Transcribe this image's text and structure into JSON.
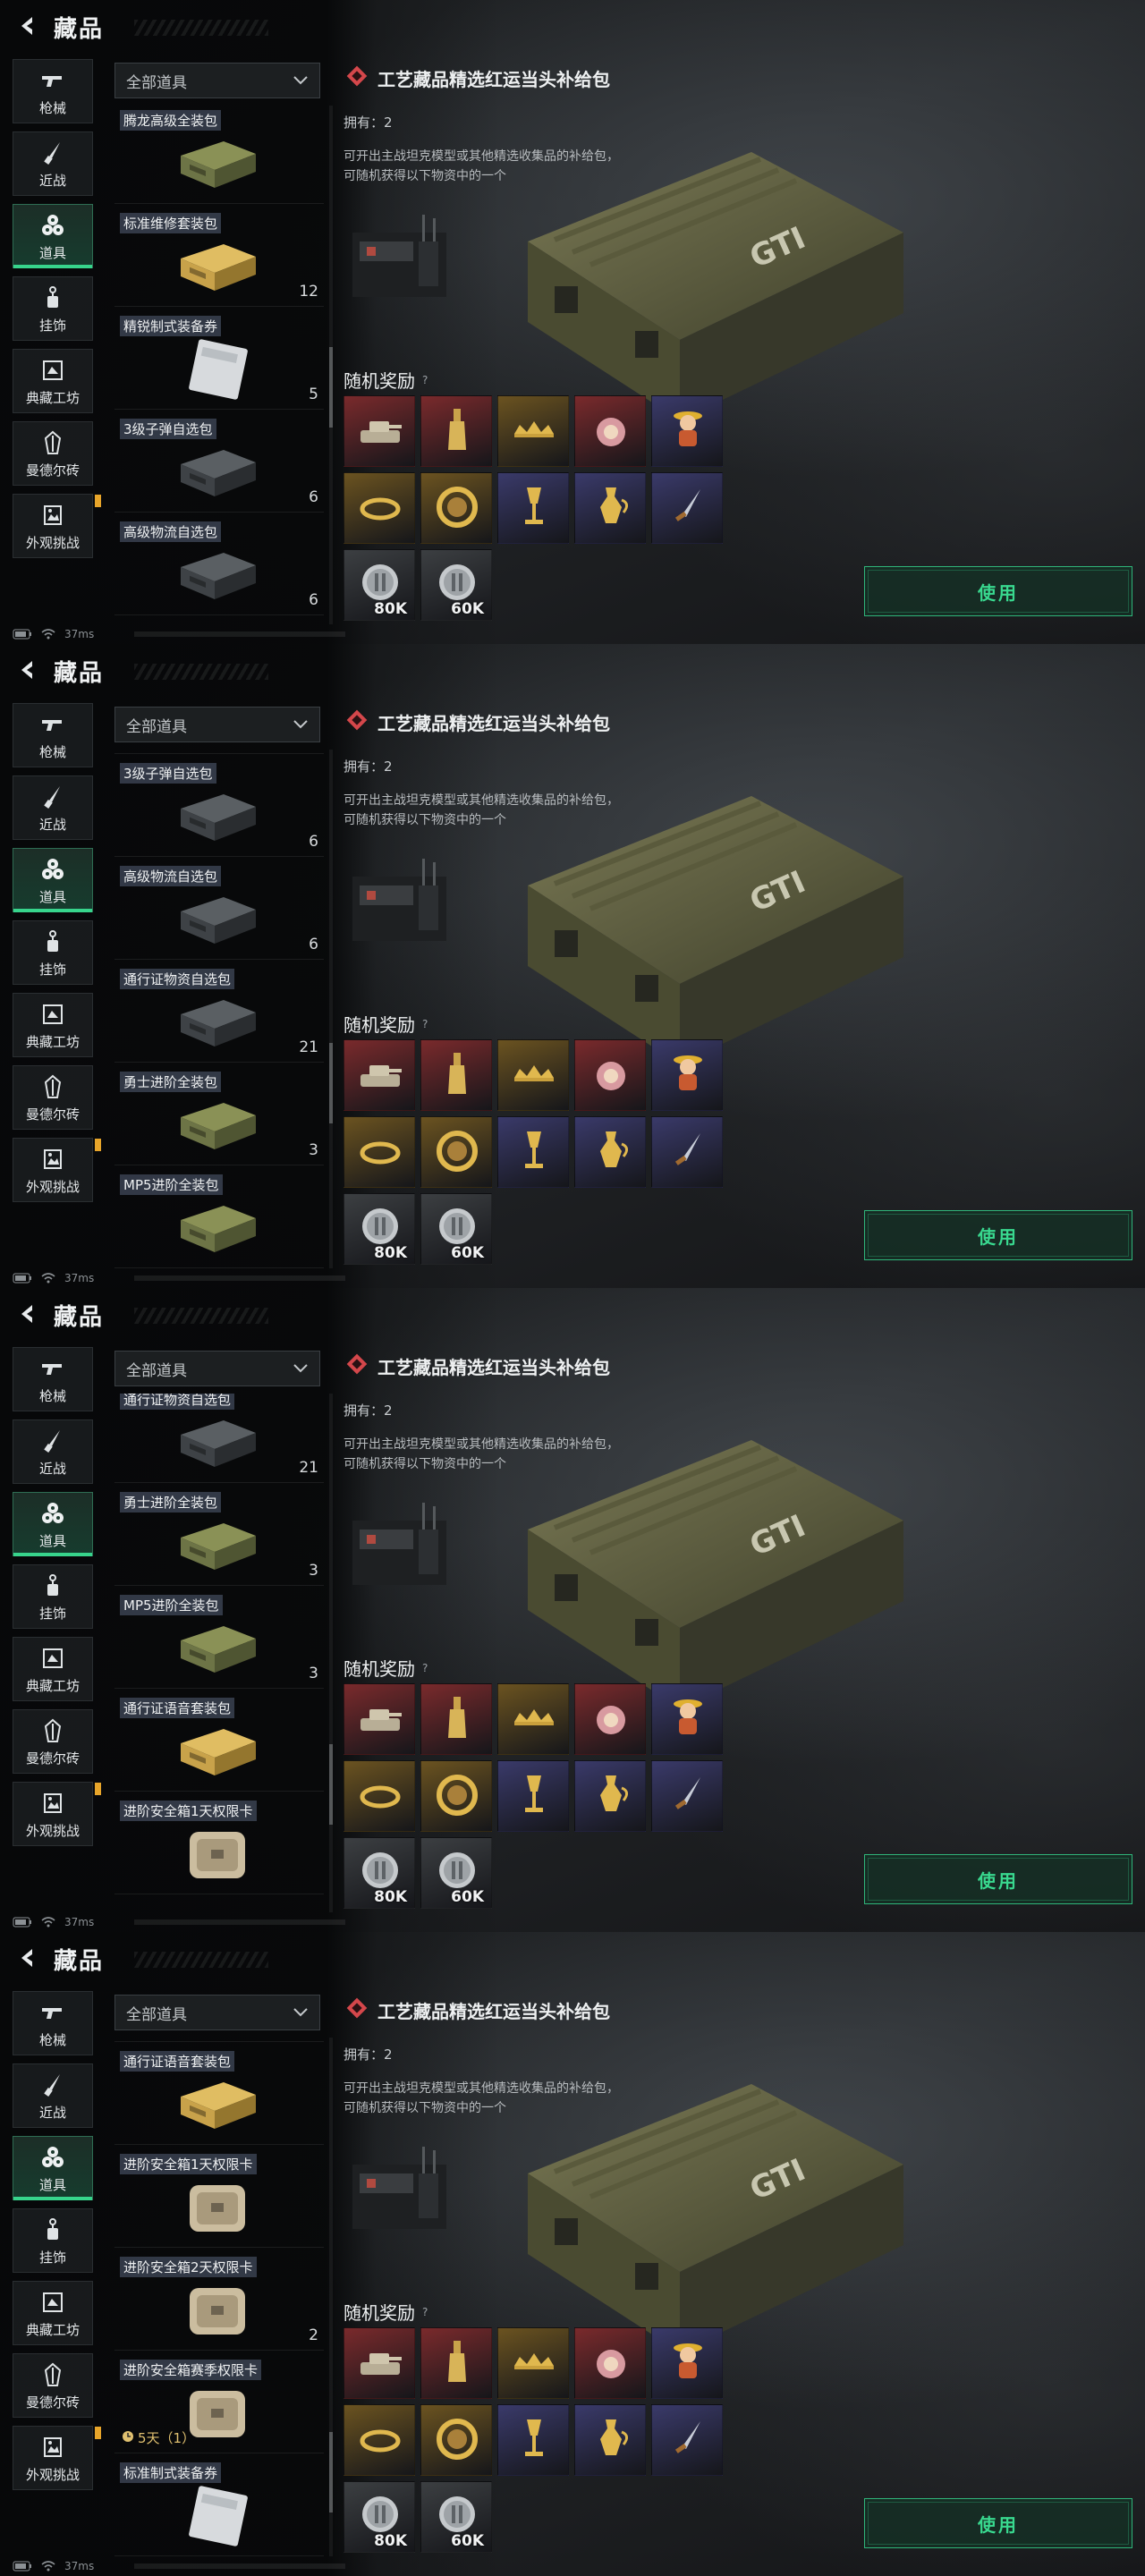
{
  "page": {
    "title": "藏品",
    "ping": "37ms"
  },
  "nav": [
    {
      "label": "枪械",
      "icon": "gun-icon"
    },
    {
      "label": "近战",
      "icon": "knife-icon"
    },
    {
      "label": "道具",
      "icon": "props-icon",
      "active": true
    },
    {
      "label": "挂饰",
      "icon": "charm-icon"
    },
    {
      "label": "典藏工坊",
      "icon": "workshop-icon"
    },
    {
      "label": "曼德尔砖",
      "icon": "brick-icon"
    },
    {
      "label": "外观挑战",
      "icon": "appearance-icon",
      "badge": true
    }
  ],
  "filter": {
    "label": "全部道具"
  },
  "detail": {
    "title": "工艺藏品精选红运当头补给包",
    "owned": "拥有：2",
    "description": "可开出主战坦克模型或其他精选收集品的补给包，可随机获得以下物资中的一个",
    "rewards_title": "随机奖励",
    "rewards": [
      {
        "icon": "tank-model-icon",
        "color": "#7a2a2c"
      },
      {
        "icon": "bottle-icon",
        "color": "#7a2a2c"
      },
      {
        "icon": "crown-icon",
        "color": "#6b5320"
      },
      {
        "icon": "medal-icon",
        "color": "#7a2a2c"
      },
      {
        "icon": "figure-icon",
        "color": "#3a3a6a"
      },
      {
        "icon": "bracelet-icon",
        "color": "#6b5320"
      },
      {
        "icon": "coin-ring-icon",
        "color": "#6b5320"
      },
      {
        "icon": "goblet-icon",
        "color": "#3a3a6a"
      },
      {
        "icon": "ewer-icon",
        "color": "#3a3a6a"
      },
      {
        "icon": "dagger-icon",
        "color": "#3a3a6a"
      },
      {
        "icon": "currency-icon",
        "color": "#3c3f42",
        "value": "80K"
      },
      {
        "icon": "currency-icon",
        "color": "#3c3f42",
        "value": "60K"
      }
    ],
    "use_label": "使用"
  },
  "catalog": {
    "tenglong": {
      "name": "腾龙高级全装包",
      "count": "",
      "style": "green-case"
    },
    "repair": {
      "name": "标准维修套装包",
      "count": "12",
      "style": "yellow-case"
    },
    "voucher": {
      "name": "精锐制式装备券",
      "count": "5",
      "style": "ticket"
    },
    "ammo": {
      "name": "3级子弹自选包",
      "count": "6",
      "style": "dark-case"
    },
    "logistics": {
      "name": "高级物流自选包",
      "count": "6",
      "style": "dark-case"
    },
    "pass": {
      "name": "通行证物资自选包",
      "count": "21",
      "style": "dark-case"
    },
    "warrior": {
      "name": "勇士进阶全装包",
      "count": "3",
      "style": "green-case"
    },
    "mp5": {
      "name": "MP5进阶全装包",
      "count": "3",
      "style": "green-case"
    },
    "voice": {
      "name": "通行证语音套装包",
      "count": "",
      "style": "yellow-case"
    },
    "safe1": {
      "name": "进阶安全箱1天权限卡",
      "count": "",
      "style": "safe"
    },
    "safe2": {
      "name": "进阶安全箱2天权限卡",
      "count": "2",
      "style": "safe"
    },
    "safe_season": {
      "name": "进阶安全箱赛季权限卡",
      "count": "",
      "style": "safe",
      "timer": "5天（1）"
    },
    "std_voucher": {
      "name": "标准制式装备券",
      "count": "",
      "style": "ticket"
    }
  },
  "lists": [
    {
      "scroll": 0.55,
      "items": [
        {
          "ref": "tenglong",
          "show_name": true,
          "show_count": true
        },
        {
          "ref": "repair",
          "show_name": true,
          "show_count": true
        },
        {
          "ref": "voucher",
          "show_name": true,
          "show_count": true
        },
        {
          "ref": "ammo",
          "show_name": true,
          "show_count": true
        },
        {
          "ref": "logistics",
          "show_name": true,
          "show_count": true
        }
      ]
    },
    {
      "scroll": 0.67,
      "items": [
        {
          "ref": "voucher",
          "show_name": false,
          "show_count": true
        },
        {
          "ref": "ammo",
          "show_name": true,
          "show_count": true
        },
        {
          "ref": "logistics",
          "show_name": true,
          "show_count": true
        },
        {
          "ref": "pass",
          "show_name": true,
          "show_count": true
        },
        {
          "ref": "warrior",
          "show_name": true,
          "show_count": true
        },
        {
          "ref": "mp5",
          "show_name": true,
          "show_count": false
        }
      ]
    },
    {
      "scroll": 0.8,
      "items": [
        {
          "ref": "pass",
          "show_name": true,
          "show_count": true
        },
        {
          "ref": "warrior",
          "show_name": true,
          "show_count": true
        },
        {
          "ref": "mp5",
          "show_name": true,
          "show_count": true
        },
        {
          "ref": "voice",
          "show_name": true,
          "show_count": false
        },
        {
          "ref": "safe1",
          "show_name": true,
          "show_count": false
        }
      ]
    },
    {
      "scroll": 0.9,
      "items": [
        {
          "ref": "mp5",
          "show_name": false,
          "show_count": true
        },
        {
          "ref": "voice",
          "show_name": true,
          "show_count": false
        },
        {
          "ref": "safe1",
          "show_name": true,
          "show_count": false
        },
        {
          "ref": "safe2",
          "show_name": true,
          "show_count": true
        },
        {
          "ref": "safe_season",
          "show_name": true,
          "show_count": false,
          "show_timer": true
        },
        {
          "ref": "std_voucher",
          "show_name": true,
          "show_count": false
        }
      ]
    }
  ]
}
